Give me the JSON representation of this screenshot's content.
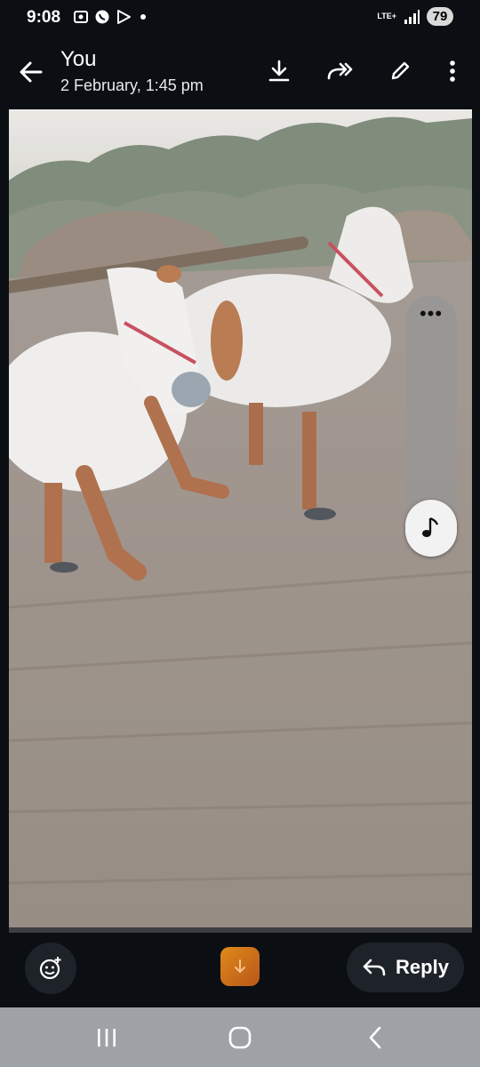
{
  "status": {
    "time": "9:08",
    "network": "LTE+",
    "battery": "79",
    "icons": [
      "screenshot-icon",
      "whatsapp-icon",
      "play-store-icon",
      "notification-dot-icon",
      "signal-icon"
    ]
  },
  "header": {
    "sender": "You",
    "timestamp": "2 February, 1:45 pm",
    "actions": [
      "download-icon",
      "forward-icon",
      "edit-icon",
      "more-vert-icon"
    ]
  },
  "media": {
    "description_icon": "photo-of-two-bullocks-plowing-field",
    "side_menu": "more-horiz-icon",
    "music_icon": "music-note-icon"
  },
  "bottom": {
    "emoji_icon": "emoji-add-icon",
    "reply_label": "Reply"
  },
  "nav": {
    "icons": [
      "recent-apps-icon",
      "home-icon",
      "back-icon"
    ]
  },
  "colors": {
    "background": "#0b0f14",
    "nav_background": "#9ea1a5",
    "accent_orange": "#d9771a"
  }
}
